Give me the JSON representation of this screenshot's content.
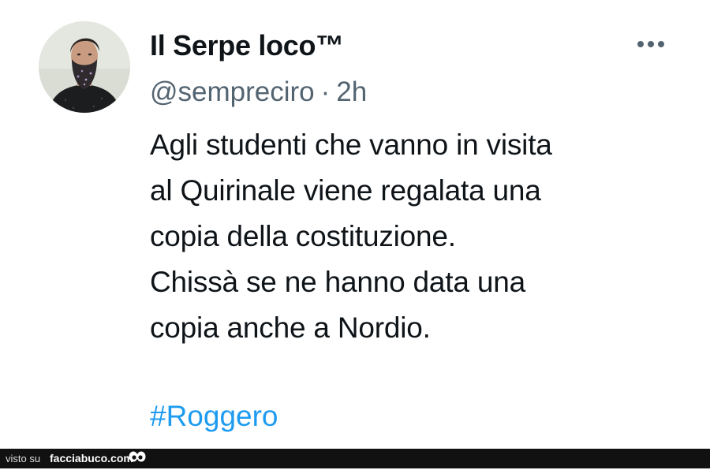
{
  "tweet": {
    "display_name": "Il Serpe loco™",
    "handle": "@sempreciro",
    "separator": "·",
    "time": "2h",
    "text_lines": [
      "Agli studenti che vanno in visita",
      "al Quirinale viene regalata una",
      "copia della costituzione.",
      "Chissà se ne hanno data una",
      "copia anche a Nordio."
    ],
    "hashtag": "#Roggero",
    "more_icon": "more-horizontal-icon",
    "avatar_icon": "profile-photo"
  },
  "footer": {
    "prefix": "visto su",
    "site": "facciabuco.com",
    "logo_icon": "eyes-icon"
  },
  "colors": {
    "text": "#0f1419",
    "secondary": "#536471",
    "link": "#1d9bf0",
    "footer_bg": "#111111"
  }
}
